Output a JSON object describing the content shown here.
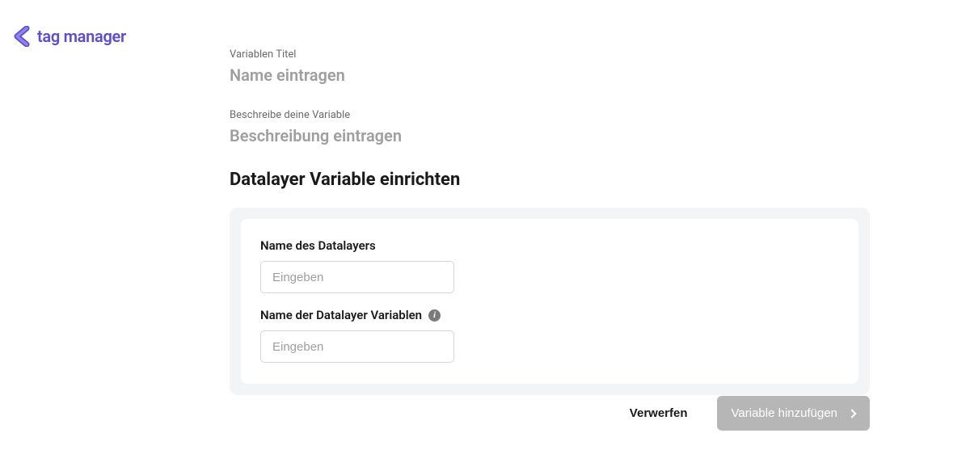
{
  "logo": {
    "text": "tag manager"
  },
  "form": {
    "title_label": "Variablen Titel",
    "title_placeholder": "Name eintragen",
    "desc_label": "Beschreibe deine Variable",
    "desc_placeholder": "Beschreibung eintragen",
    "section_heading": "Datalayer Variable einrichten",
    "dl_name_label": "Name des Datalayers",
    "dl_name_placeholder": "Eingeben",
    "dl_var_label": "Name der Datalayer Variablen",
    "dl_var_placeholder": "Eingeben"
  },
  "footer": {
    "discard": "Verwerfen",
    "add": "Variable hinzufügen"
  }
}
